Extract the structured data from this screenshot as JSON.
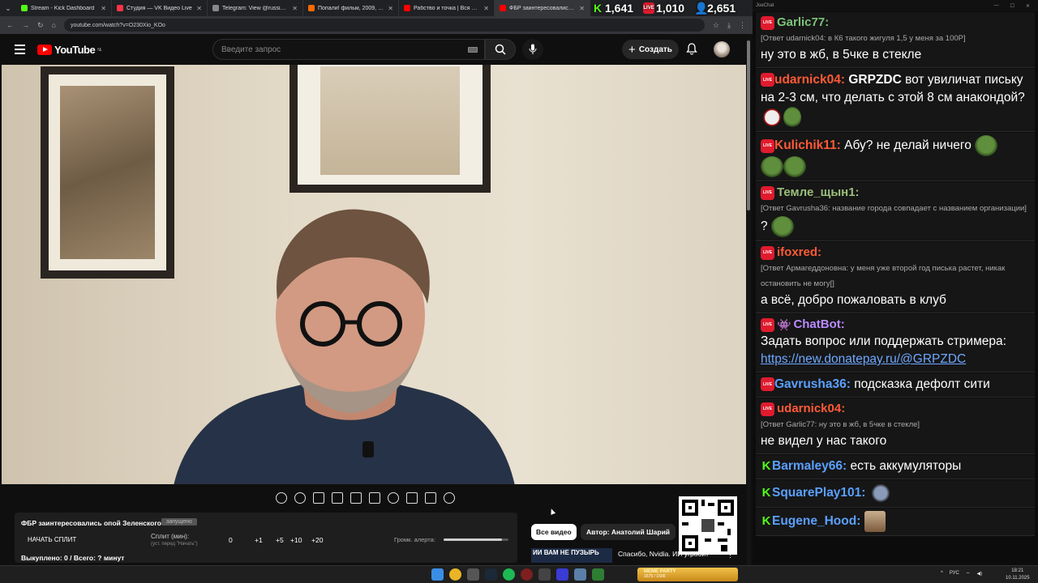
{
  "browser": {
    "tabs": [
      {
        "title": "Stream - Kick Dashboard",
        "color": "#53fc18"
      },
      {
        "title": "Студия — VK Видео Live",
        "color": "#ff3347"
      },
      {
        "title": "Telegram: View @russiainmyw…",
        "color": "#888888"
      },
      {
        "title": "Попали! фильм, 2009, дата вы…",
        "color": "#ff6a00"
      },
      {
        "title": "Рабство и точка | Вся правда…",
        "color": "#ff0000"
      },
      {
        "title": "ФБР заинтересовались опо…",
        "color": "#ff0000"
      }
    ],
    "url": "youtube.com/watch?v=O230Xio_KOo"
  },
  "counters": [
    {
      "icon": "kick-icon",
      "value": "1,641",
      "color": "#53fc18"
    },
    {
      "icon": "vk-live-icon",
      "value": "1,010",
      "color": "#e01b2e"
    },
    {
      "icon": "viewer-icon",
      "value": "2,651",
      "color": "#5aa0ff"
    }
  ],
  "youtube": {
    "logo": "YouTube",
    "region": "NL",
    "search_placeholder": "Введите запрос",
    "create_label": "Создать"
  },
  "plugin": {
    "video_title": "ФБР заинтересовались опой Зеленского",
    "tag": "запущено",
    "start_split": "НАЧАТЬ СПЛИТ",
    "split_label": "Сплит (мин):",
    "split_hint": "(уст. перед \"Начать\")",
    "split_value": "0",
    "increments": [
      "+1",
      "+5",
      "+10",
      "+20"
    ],
    "volume_label": "Громк. алерта:",
    "volume_level": 0.9,
    "bought": "Выкуплено: 0 / Всего: ? минут"
  },
  "related": {
    "chip_all": "Все видео",
    "chip_author": "Автор: Анатолий Шарий",
    "thumb_text": "ИИ ВАМ НЕ ПУЗЫРЬ",
    "title": "Спасибо, Nvidia. ИИ угробит"
  },
  "chat": {
    "app_name": "JoeChat",
    "messages": [
      {
        "platform": "vk",
        "name": "Garlic77:",
        "color": "#7cc47a",
        "reply": "[Ответ udarnick04: в К6 такого жигуля 1,5 у меня за 100Р]",
        "text": "ну это в жб, в 5чке в стекле"
      },
      {
        "platform": "vk",
        "name": "udarnick04:",
        "color": "#ff5a36",
        "bold": "GRPZDC",
        "text": " вот увиличат письку на 2-3 см, что делать с этой 8 см анакондой?"
      },
      {
        "platform": "vk",
        "name": "Kulichik11:",
        "color": "#ff5a36",
        "text": "Абу? не делай ничего"
      },
      {
        "platform": "vk",
        "name": "Темле_щын1:",
        "color": "#9bbf7a",
        "reply": "[Ответ Gavrusha36: название города совпадает с названием организации]",
        "text": "?"
      },
      {
        "platform": "vk",
        "name": "ifoxred:",
        "color": "#ff5a36",
        "reply": "[Ответ Армагеддоновна: у меня уже второй год писька растет, никак остановить не могу[]",
        "text": "а всё, добро пожаловать в клуб"
      },
      {
        "platform": "vk",
        "name": "ChatBot:",
        "color": "#b98bff",
        "text": "Задать вопрос или поддержать стримера:",
        "link": "https://new.donatepay.ru/@GRPZDC"
      },
      {
        "platform": "vk",
        "name": "Gavrusha36:",
        "color": "#5aa0ff",
        "text": "подсказка дефолт сити"
      },
      {
        "platform": "vk",
        "name": "udarnick04:",
        "color": "#ff5a36",
        "reply": "[Ответ Garlic77: ну это в жб, в 5чке в стекле]",
        "text": "не видел у нас такого"
      },
      {
        "platform": "kick",
        "name": "Barmaley66:",
        "color": "#5aa0ff",
        "text": "есть аккумуляторы"
      },
      {
        "platform": "kick",
        "name": "SquarePlay101:",
        "color": "#5aa0ff",
        "text": ""
      },
      {
        "platform": "kick",
        "name": "Eugene_Hood:",
        "color": "#5aa0ff",
        "text": ""
      }
    ]
  },
  "taskbar": {
    "kick_widget": "MEME PARTY",
    "kick_widget_stats": "1675 / 1500",
    "lang": "РУС",
    "time": "18:21",
    "date": "10.11.2025"
  }
}
